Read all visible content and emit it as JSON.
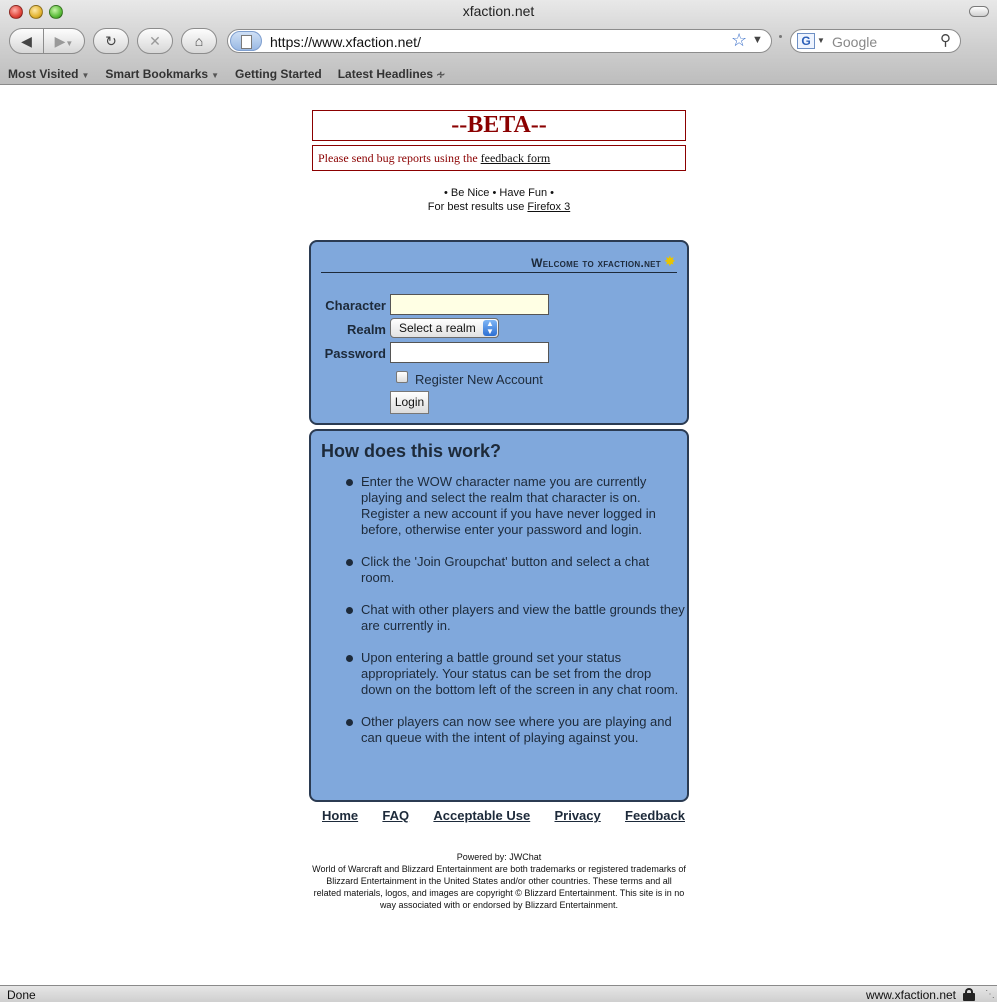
{
  "window": {
    "title": "xfaction.net"
  },
  "toolbar": {
    "url": "https://www.xfaction.net/",
    "search_placeholder": "Google",
    "search_engine": "G"
  },
  "bookmarks": [
    {
      "label": "Most Visited",
      "dropdown": true
    },
    {
      "label": "Smart Bookmarks",
      "dropdown": true
    },
    {
      "label": "Getting Started",
      "dropdown": false
    },
    {
      "label": "Latest Headlines",
      "dropdown": false,
      "rss": true
    }
  ],
  "beta": {
    "title": "--BETA--",
    "note_prefix": "Please send bug reports using the ",
    "note_link": "feedback form"
  },
  "motto": {
    "line1": "• Be Nice • Have Fun •",
    "line2_prefix": "For best results use ",
    "line2_link": "Firefox 3"
  },
  "login": {
    "welcome": "Welcome to xfaction.net",
    "character_label": "Character",
    "realm_label": "Realm",
    "realm_selected": "Select a realm",
    "password_label": "Password",
    "register_label": "Register New Account",
    "login_button": "Login"
  },
  "howto": {
    "title": "How does this work?",
    "items": [
      "Enter the WOW character name you are currently playing and select the realm that character is on. Register a new account if you have never logged in before, otherwise enter your password and login.",
      "Click the 'Join Groupchat' button and select a chat room.",
      "Chat with other players and view the battle grounds they are currently in.",
      "Upon entering a battle ground set your status appropriately. Your status can be set from the drop down on the bottom left of the screen in any chat room.",
      "Other players can now see where you are playing and can queue with the intent of playing against you."
    ]
  },
  "footer_nav": [
    "Home",
    "FAQ",
    "Acceptable Use",
    "Privacy",
    "Feedback"
  ],
  "powered": {
    "line1": "Powered by: JWChat",
    "legal": "World of Warcraft and Blizzard Entertainment are both trademarks or registered trademarks of Blizzard Entertainment in the United States and/or other countries. These terms and all related materials, logos, and images are copyright © Blizzard Entertainment. This site is in no way associated with or endorsed by Blizzard Entertainment."
  },
  "status": {
    "text": "Done",
    "host": "www.xfaction.net"
  }
}
